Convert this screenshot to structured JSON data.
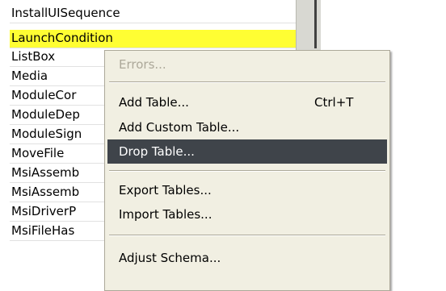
{
  "table_list": {
    "items": [
      {
        "label": "InstallUISequence",
        "selected": false
      },
      {
        "label": "LaunchCondition",
        "selected": true
      },
      {
        "label": "ListBox",
        "selected": false
      },
      {
        "label": "Media",
        "selected": false
      },
      {
        "label": "ModuleCor",
        "selected": false
      },
      {
        "label": "ModuleDep",
        "selected": false
      },
      {
        "label": "ModuleSign",
        "selected": false
      },
      {
        "label": "MoveFile",
        "selected": false
      },
      {
        "label": "MsiAssemb",
        "selected": false
      },
      {
        "label": "MsiAssemb",
        "selected": false
      },
      {
        "label": "MsiDriverP",
        "selected": false
      },
      {
        "label": "MsiFileHas",
        "selected": false
      }
    ]
  },
  "context_menu": {
    "errors_label": "Errors...",
    "add_table_label": "Add Table...",
    "add_table_shortcut": "Ctrl+T",
    "add_custom_table_label": "Add Custom Table...",
    "drop_table_label": "Drop Table...",
    "export_tables_label": "Export Tables...",
    "import_tables_label": "Import Tables...",
    "adjust_schema_label": "Adjust Schema..."
  },
  "colors": {
    "selection_highlight": "#fffe33",
    "menu_background": "#f1efe2",
    "menu_hover": "#3f444a",
    "disabled_text": "#aca899"
  }
}
